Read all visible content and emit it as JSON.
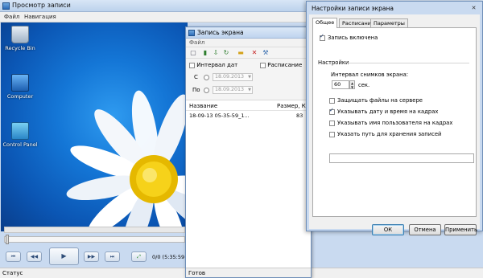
{
  "main_window": {
    "title": "Просмотр записи",
    "menu": [
      "Файл",
      "Навигация"
    ],
    "desktop_icons": [
      "Recycle Bin",
      "Computer",
      "Control Panel"
    ],
    "controls": {
      "buttons": [
        "first-icon",
        "prev-icon",
        "play-icon",
        "next-icon",
        "last-icon",
        "fit-icon"
      ],
      "time_readout": "0/0 (5:35:59 18"
    },
    "status": "Статус"
  },
  "recording_window": {
    "title": "Запись экрана",
    "menu": "Файл",
    "toolbar_icons": [
      "new-icon",
      "save-icon",
      "export-icon",
      "refresh-icon",
      "folder-icon",
      "delete-icon",
      "settings-icon"
    ],
    "filter": {
      "date_interval_label": "Интервал дат",
      "schedule_label": "Расписание",
      "from_label": "С",
      "from_value": "18.09.2013",
      "to_label": "По",
      "to_value": "18.09.2013"
    },
    "list": {
      "columns": [
        "Название",
        "Размер, Кб"
      ],
      "rows": [
        {
          "name": "18-09-13 05-35-59_1...",
          "size": "83"
        }
      ]
    },
    "status": "Готов"
  },
  "settings_dialog": {
    "title": "Настройки записи экрана",
    "close": "✕",
    "tabs": [
      "Общее",
      "Расписания",
      "Параметры"
    ],
    "active_tab": "Общее",
    "recording_enabled_label": "Запись включена",
    "recording_enabled": true,
    "settings_group_label": "Настройки",
    "interval_label": "Интервал снимков экрана:",
    "interval_value": "60",
    "interval_unit": "сек.",
    "options": [
      {
        "label": "Защищать файлы на сервере",
        "checked": false
      },
      {
        "label": "Указывать дату и время на кадрах",
        "checked": true
      },
      {
        "label": "Указывать имя пользователя на кадрах",
        "checked": false
      },
      {
        "label": "Указать путь для хранения записей",
        "checked": false
      }
    ],
    "path_value": "",
    "buttons": {
      "ok": "ОК",
      "cancel": "Отмена",
      "apply": "Применить"
    }
  }
}
